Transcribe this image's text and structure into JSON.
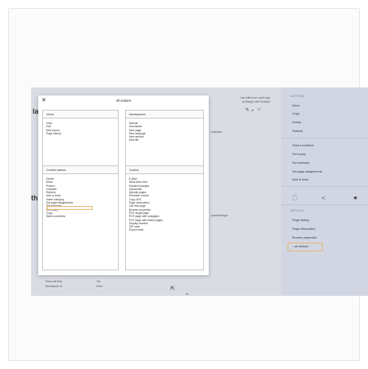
{
  "background_page": {
    "last_edit": "Last edited one month ago",
    "last_edit_by": "by Mangil Limb Rodrique",
    "side_letters": [
      "la",
      "th"
    ],
    "mid_texts": [
      "nespaces.",
      "spaceManager."
    ],
    "footer_rows": [
      {
        "key": "Show edit links",
        "value": "Yes"
      },
      {
        "key": "Namespace ID",
        "value": "Used"
      }
    ],
    "page_number": "40"
  },
  "right_panel": {
    "actions_heading": "ACTIONS",
    "actions": [
      "Move",
      "Copy",
      "Delete",
      "Refresh"
    ],
    "workflow_items": [
      "Start a workflow",
      "Set expiry",
      "Set reminder",
      "Set page assignments",
      "Add to book"
    ],
    "details_heading": "DETAILS",
    "details": [
      "Page history",
      "Page information",
      "Browse properties",
      "...all actions"
    ]
  },
  "dialog": {
    "title": "All actions",
    "sections": {
      "views": {
        "heading": "Views",
        "items": [
          "View",
          "Edit",
          "Edit source",
          "Page history"
        ]
      },
      "namespaces": {
        "heading": "Namespaces",
        "items": [
          "Manual",
          "Discussion",
          "New page",
          "New subpage",
          "New section",
          "New file"
        ]
      },
      "content_actions": {
        "heading": "Content actions",
        "items": [
          "Delete",
          "Move",
          "Protect",
          "Unwatch",
          "Refresh",
          "Add to book",
          "Insert category",
          "Set page assignments",
          "Set reminder",
          "Set expiry",
          "Copy",
          "Start a workflow"
        ]
      },
      "toolbox": {
        "heading": "Toolbox",
        "items": [
          "E-Mail",
          "What links here",
          "Related changes",
          "Upload file",
          "Special pages",
          "Printable version",
          "Copy URL",
          "Page information",
          "Cite this page",
          "Browse properties",
          "PDF single page",
          "PDF page with subpages",
          "PDF page with linked pages",
          "Display readers",
          "QR code",
          "Export book"
        ]
      }
    }
  },
  "icons": [
    "close-icon",
    "pencil-icon",
    "chevron-down-icon",
    "history-icon",
    "file-icon",
    "share-icon",
    "star-icon",
    "mouse-cursor-icon"
  ],
  "colors": {
    "highlight": "#e8b56a",
    "panel": "#d2d6e3",
    "overlay": "#dadce4"
  }
}
